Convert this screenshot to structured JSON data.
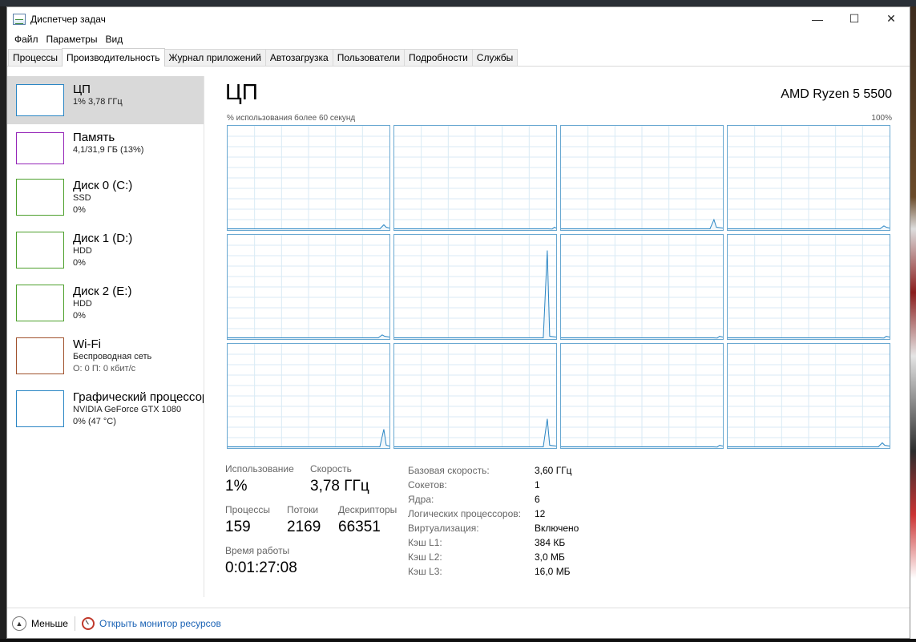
{
  "window": {
    "title": "Диспетчер задач"
  },
  "menu": [
    "Файл",
    "Параметры",
    "Вид"
  ],
  "tabs": [
    {
      "label": "Процессы",
      "active": false
    },
    {
      "label": "Производительность",
      "active": true
    },
    {
      "label": "Журнал приложений",
      "active": false
    },
    {
      "label": "Автозагрузка",
      "active": false
    },
    {
      "label": "Пользователи",
      "active": false
    },
    {
      "label": "Подробности",
      "active": false
    },
    {
      "label": "Службы",
      "active": false
    }
  ],
  "sidebar": {
    "items": [
      {
        "name": "ЦП",
        "line1": "1% 3,78 ГГц",
        "line2": "",
        "type": "cpu"
      },
      {
        "name": "Память",
        "line1": "4,1/31,9 ГБ (13%)",
        "line2": "",
        "type": "mem"
      },
      {
        "name": "Диск 0 (C:)",
        "line1": "SSD",
        "line2": "0%",
        "type": "disk"
      },
      {
        "name": "Диск 1 (D:)",
        "line1": "HDD",
        "line2": "0%",
        "type": "disk"
      },
      {
        "name": "Диск 2 (E:)",
        "line1": "HDD",
        "line2": "0%",
        "type": "disk"
      },
      {
        "name": "Wi-Fi",
        "line1": "Беспроводная сеть",
        "line2": "О: 0 П: 0 кбит/с",
        "type": "wifi"
      },
      {
        "name": "Графический процессор 0",
        "line1": "NVIDIA GeForce GTX 1080",
        "line2": "0% (47 °C)",
        "type": "gpu"
      }
    ]
  },
  "cpu": {
    "title": "ЦП",
    "model": "AMD Ryzen 5 5500",
    "axis_label": "% использования более 60 секунд",
    "axis_max": "100%",
    "stats": {
      "usage_label": "Использование",
      "usage": "1%",
      "speed_label": "Скорость",
      "speed": "3,78 ГГц",
      "processes_label": "Процессы",
      "processes": "159",
      "threads_label": "Потоки",
      "threads": "2169",
      "handles_label": "Дескрипторы",
      "handles": "66351",
      "uptime_label": "Время работы",
      "uptime": "0:01:27:08"
    },
    "details": [
      {
        "key": "Базовая скорость:",
        "value": "3,60 ГГц"
      },
      {
        "key": "Сокетов:",
        "value": "1"
      },
      {
        "key": "Ядра:",
        "value": "6"
      },
      {
        "key": "Логических процессоров:",
        "value": "12"
      },
      {
        "key": "Виртуализация:",
        "value": "Включено"
      },
      {
        "key": "Кэш L1:",
        "value": "384 КБ"
      },
      {
        "key": "Кэш L2:",
        "value": "3,0 МБ"
      },
      {
        "key": "Кэш L3:",
        "value": "16,0 МБ"
      }
    ],
    "core_graphs": [
      {
        "core": 0,
        "spike_pos": 0.97,
        "spike_pct": 5
      },
      {
        "core": 1,
        "spike_pos": 0.98,
        "spike_pct": 1
      },
      {
        "core": 2,
        "spike_pos": 0.95,
        "spike_pct": 10
      },
      {
        "core": 3,
        "spike_pos": 0.97,
        "spike_pct": 4
      },
      {
        "core": 4,
        "spike_pos": 0.96,
        "spike_pct": 4
      },
      {
        "core": 5,
        "spike_pos": 0.95,
        "spike_pct": 85
      },
      {
        "core": 6,
        "spike_pos": 0.97,
        "spike_pct": 1
      },
      {
        "core": 7,
        "spike_pos": 0.97,
        "spike_pct": 1
      },
      {
        "core": 8,
        "spike_pos": 0.97,
        "spike_pct": 18
      },
      {
        "core": 9,
        "spike_pos": 0.95,
        "spike_pct": 28
      },
      {
        "core": 10,
        "spike_pos": 0.97,
        "spike_pct": 1
      },
      {
        "core": 11,
        "spike_pos": 0.96,
        "spike_pct": 5
      }
    ]
  },
  "footer": {
    "less_label": "Меньше",
    "monitor_label": "Открыть монитор ресурсов"
  },
  "colors": {
    "accent": "#2b86c4",
    "graph_line": "#2b86c4",
    "graph_grid": "#d9eaf5",
    "link": "#1b63b5"
  }
}
